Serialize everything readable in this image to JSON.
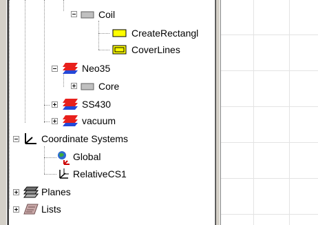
{
  "tree": {
    "coil": {
      "label": "Coil",
      "icon": "gray-box-icon"
    },
    "create_rectangle": {
      "label": "CreateRectangl",
      "icon": "yellow-rectangle-icon"
    },
    "cover_lines": {
      "label": "CoverLines",
      "icon": "yellow-cover-lines-icon"
    },
    "neo35": {
      "label": "Neo35",
      "icon": "material-box-icon"
    },
    "core": {
      "label": "Core",
      "icon": "gray-box-icon"
    },
    "ss430": {
      "label": "SS430",
      "icon": "material-box-icon"
    },
    "vacuum": {
      "label": "vacuum",
      "icon": "material-box-icon"
    },
    "coordinate_systems": {
      "label": "Coordinate Systems",
      "icon": "axes-icon"
    },
    "global": {
      "label": "Global",
      "icon": "globe-axes-icon"
    },
    "relative_cs1": {
      "label": "RelativeCS1",
      "icon": "relative-axes-icon"
    },
    "planes": {
      "label": "Planes",
      "icon": "planes-stack-icon"
    },
    "lists": {
      "label": "Lists",
      "icon": "lists-icon"
    }
  },
  "colors": {
    "material_red": "#e8201c",
    "material_blue": "#2448d8",
    "gray_box": "#c0c0c0",
    "yellow_op": "#ffff00"
  }
}
